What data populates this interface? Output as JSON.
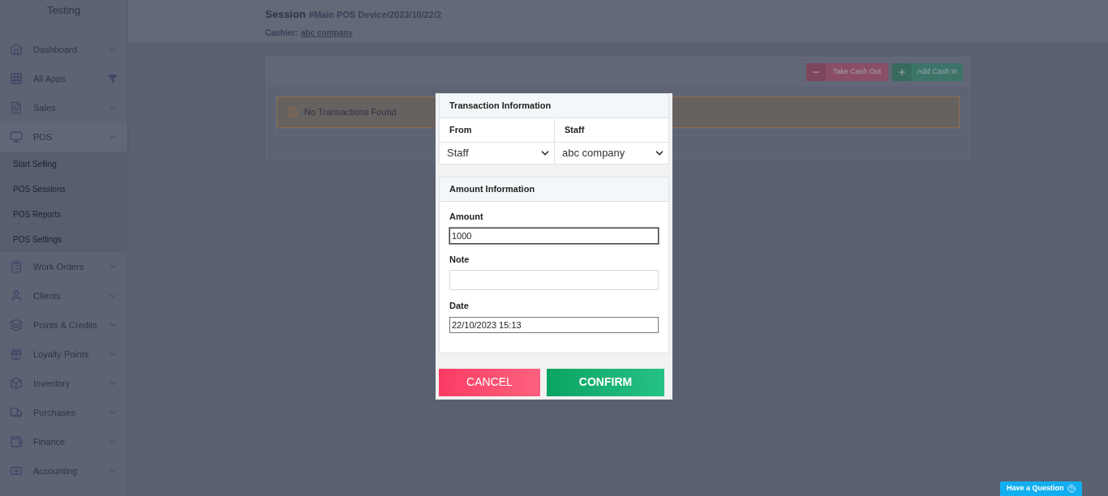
{
  "sidebar": {
    "title": "Testing",
    "items": [
      {
        "kind": "menu",
        "label": "Dashboard",
        "expanded": false
      },
      {
        "kind": "filter",
        "label": "All Apps"
      },
      {
        "kind": "menu",
        "label": "Sales",
        "expanded": false
      },
      {
        "kind": "menu",
        "label": "POS",
        "expanded": true,
        "children": [
          {
            "label": "Start Selling"
          },
          {
            "label": "POS Sessions"
          },
          {
            "label": "POS Reports"
          },
          {
            "label": "POS Settings"
          }
        ]
      },
      {
        "kind": "menu",
        "label": "Work Orders",
        "expanded": false
      },
      {
        "kind": "menu",
        "label": "Clients",
        "expanded": false
      },
      {
        "kind": "menu",
        "label": "Points & Credits",
        "expanded": false
      },
      {
        "kind": "menu",
        "label": "Loyalty Points",
        "expanded": false
      },
      {
        "kind": "menu",
        "label": "Inventory",
        "expanded": false
      },
      {
        "kind": "menu",
        "label": "Purchases",
        "expanded": false
      },
      {
        "kind": "menu",
        "label": "Finance",
        "expanded": false
      },
      {
        "kind": "menu",
        "label": "Accounting",
        "expanded": false
      }
    ]
  },
  "header": {
    "title": "Session",
    "session_id": "#Main POS Device/2023/10/22/2",
    "cashier_label": "Cashier:",
    "cashier": "abc company"
  },
  "actions": [
    {
      "kind": "out",
      "label": "Take Cash Out"
    },
    {
      "kind": "in",
      "label": "Add Cash In"
    }
  ],
  "alert": "No Transactions Found",
  "modal": {
    "transaction_title": "Transaction Information",
    "columns": [
      {
        "heading": "From",
        "value": "Staff"
      },
      {
        "heading": "Staff",
        "value": "abc company"
      }
    ],
    "amount_title": "Amount Information",
    "fields": [
      {
        "label": "Amount",
        "value": "1000",
        "focused": true
      },
      {
        "label": "Note",
        "focused": false
      },
      {
        "label": "Date",
        "value": "22/10/2023 15:13",
        "focused": false
      }
    ],
    "cancel": "CANCEL",
    "confirm": "CONFIRM"
  },
  "help_button": "Have a Question"
}
